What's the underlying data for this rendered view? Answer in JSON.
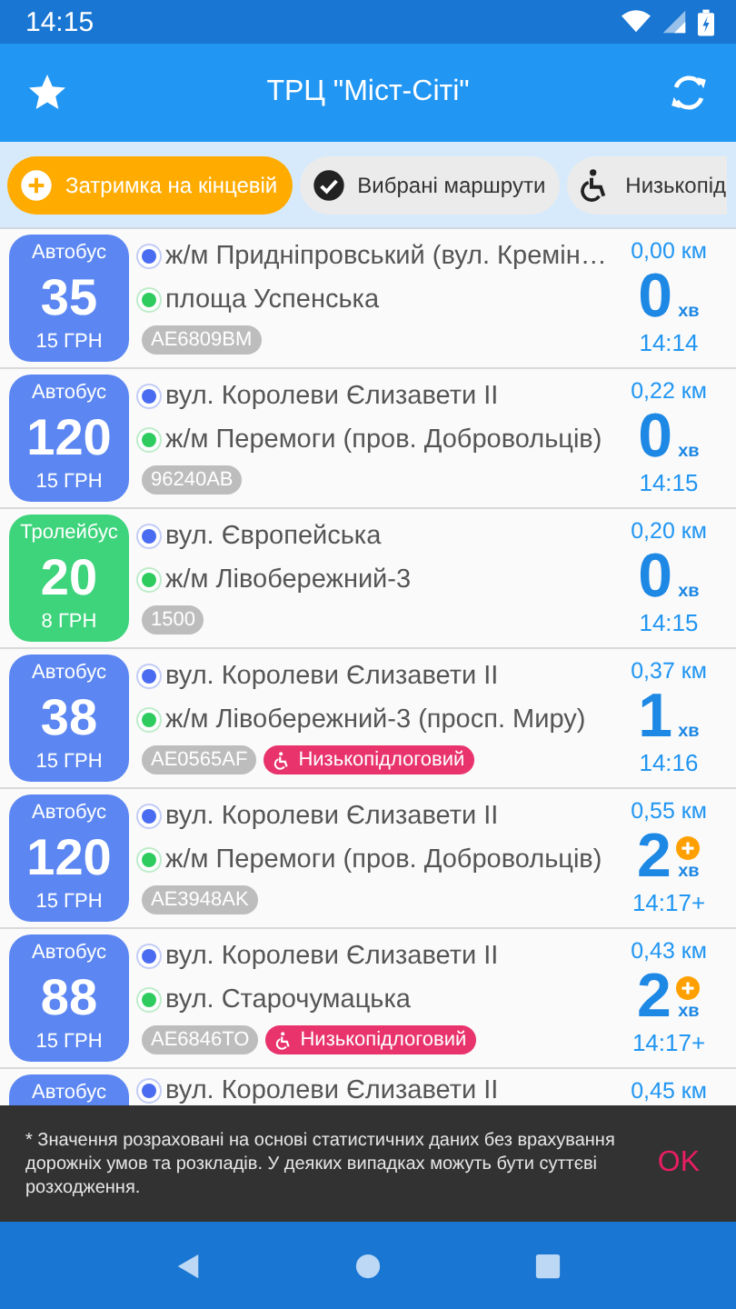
{
  "status_bar": {
    "time": "14:15"
  },
  "app_bar": {
    "title": "ТРЦ \"Міст-Сіті\""
  },
  "chips": [
    {
      "kind": "delay",
      "label": "Затримка на кінцевій",
      "on": true
    },
    {
      "kind": "favorites",
      "label": "Вибрані маршрути",
      "on": false
    },
    {
      "kind": "low_floor",
      "label": "Низькопід",
      "on": false
    }
  ],
  "rows": [
    {
      "type": "Автобус",
      "color": "#5c87f2",
      "number": "35",
      "price": "15 ГРН",
      "from": "ж/м Придніпровський (вул. Кремін…",
      "to": "площа Успенська",
      "tags": [
        {
          "kind": "plate",
          "text": "AE6809BM"
        }
      ],
      "distance": "0,00 км",
      "minutes": "0",
      "unit": "хв",
      "time": "14:14",
      "estimated": false
    },
    {
      "type": "Автобус",
      "color": "#5c87f2",
      "number": "120",
      "price": "15 ГРН",
      "from": "вул. Королеви Єлизавети II",
      "to": "ж/м Перемоги (пров. Добровольців)",
      "tags": [
        {
          "kind": "plate",
          "text": "96240AB"
        }
      ],
      "distance": "0,22 км",
      "minutes": "0",
      "unit": "хв",
      "time": "14:15",
      "estimated": false
    },
    {
      "type": "Тролейбус",
      "color": "#3ed47c",
      "number": "20",
      "price": "8 ГРН",
      "from": "вул. Європейська",
      "to": "ж/м Лівобережний-3",
      "tags": [
        {
          "kind": "plate",
          "text": "1500"
        }
      ],
      "distance": "0,20 км",
      "minutes": "0",
      "unit": "хв",
      "time": "14:15",
      "estimated": false
    },
    {
      "type": "Автобус",
      "color": "#5c87f2",
      "number": "38",
      "price": "15 ГРН",
      "from": "вул. Королеви Єлизавети II",
      "to": "ж/м Лівобережний-3 (просп. Миру)",
      "tags": [
        {
          "kind": "plate",
          "text": "AE0565AF"
        },
        {
          "kind": "low_floor",
          "text": "Низькопідлоговий"
        }
      ],
      "distance": "0,37 км",
      "minutes": "1",
      "unit": "хв",
      "time": "14:16",
      "estimated": false
    },
    {
      "type": "Автобус",
      "color": "#5c87f2",
      "number": "120",
      "price": "15 ГРН",
      "from": "вул. Королеви Єлизавети II",
      "to": "ж/м Перемоги (пров. Добровольців)",
      "tags": [
        {
          "kind": "plate",
          "text": "AE3948AK"
        }
      ],
      "distance": "0,55 км",
      "minutes": "2",
      "unit": "хв",
      "time": "14:17+",
      "estimated": true
    },
    {
      "type": "Автобус",
      "color": "#5c87f2",
      "number": "88",
      "price": "15 ГРН",
      "from": "вул. Королеви Єлизавети II",
      "to": "вул. Старочумацька",
      "tags": [
        {
          "kind": "plate",
          "text": "AE6846TO"
        },
        {
          "kind": "low_floor",
          "text": "Низькопідлоговий"
        }
      ],
      "distance": "0,43 км",
      "minutes": "2",
      "unit": "хв",
      "time": "14:17+",
      "estimated": true
    },
    {
      "type": "Автобус",
      "color": "#5c87f2",
      "from": "вул. Королеви Єлизавети II",
      "distance": "0,45 км"
    }
  ],
  "snackbar": {
    "message": "* Значення розраховані на основі статистичних даних без врахування дорожніх умов та розкладів. У деяких випадках можуть бути суттєві розходження.",
    "action": "OK"
  }
}
